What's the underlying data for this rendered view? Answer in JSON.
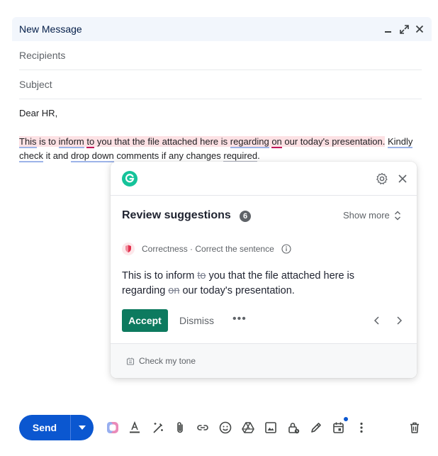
{
  "window": {
    "title": "New Message"
  },
  "fields": {
    "recipients_placeholder": "Recipients",
    "subject_placeholder": "Subject"
  },
  "body": {
    "greeting": "Dear HR,",
    "sentence": {
      "w_this": "This",
      "t1": " is to ",
      "w_inform": "inform",
      "t2": " ",
      "w_to": "to",
      "t3": " you that the file attached here is ",
      "w_regarding": "regarding",
      "t4": " ",
      "w_on": "on",
      "t5": " our today's presentation.",
      "t6": " ",
      "w_kindly": "Kindly",
      "t7": " ",
      "w_check": "check",
      "t8": " it and ",
      "w_drop": "drop down",
      "t9": " comments if any changes ",
      "w_required": "required",
      "t10": "."
    }
  },
  "grammarly": {
    "title": "Review suggestions",
    "count": "6",
    "show_more": "Show more",
    "category": "Correctness · Correct the sentence",
    "suggestion": {
      "p1": "This is to inform ",
      "del1": "to",
      "p2": " you that the file attached here is regarding ",
      "del2": "on",
      "p3": " our today's presentation."
    },
    "accept": "Accept",
    "dismiss": "Dismiss",
    "more": "•••",
    "footer": "Check my tone"
  },
  "toolbar": {
    "send": "Send"
  },
  "colors": {
    "send_blue": "#0b57d0",
    "accept_green": "#0d7a5f",
    "highlight_pink": "#fde1e4",
    "grammarly_logo": "#15c39a"
  },
  "icons": {
    "titlebar": [
      "minimize-icon",
      "expand-icon",
      "close-icon"
    ],
    "toolbar": [
      "ai-assist-icon",
      "text-format-icon",
      "magic-pen-icon",
      "attach-icon",
      "link-icon",
      "emoji-icon",
      "drive-icon",
      "image-icon",
      "confidential-lock-icon",
      "signature-pen-icon",
      "schedule-calendar-icon",
      "more-vert-icon",
      "trash-icon"
    ]
  }
}
